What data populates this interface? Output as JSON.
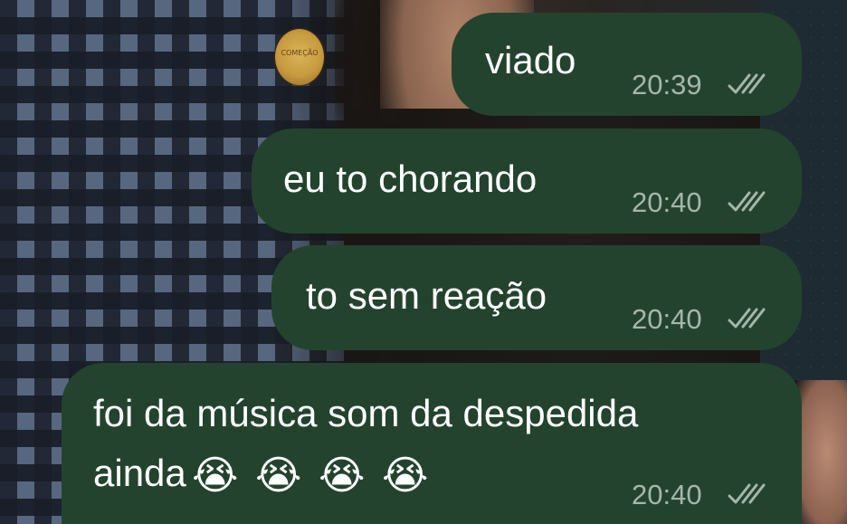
{
  "chat": {
    "messages": [
      {
        "text": "viado",
        "time": "20:39"
      },
      {
        "text": "eu to chorando",
        "time": "20:40"
      },
      {
        "text": "to sem reação",
        "time": "20:40"
      },
      {
        "text_line1": "foi da música som da despedida",
        "text_line2": "ainda",
        "emojis": [
          "😭",
          "😭",
          "😭",
          "😭"
        ],
        "time": "20:40"
      }
    ],
    "status_icon": "double-check-icon"
  },
  "wallpaper": {
    "badge_text": "COMEÇÃO"
  },
  "colors": {
    "bubble_bg": "#24432f",
    "message_text": "#ffffff",
    "meta_text": "#a5b7aa",
    "ticks": "#a5b7aa"
  }
}
